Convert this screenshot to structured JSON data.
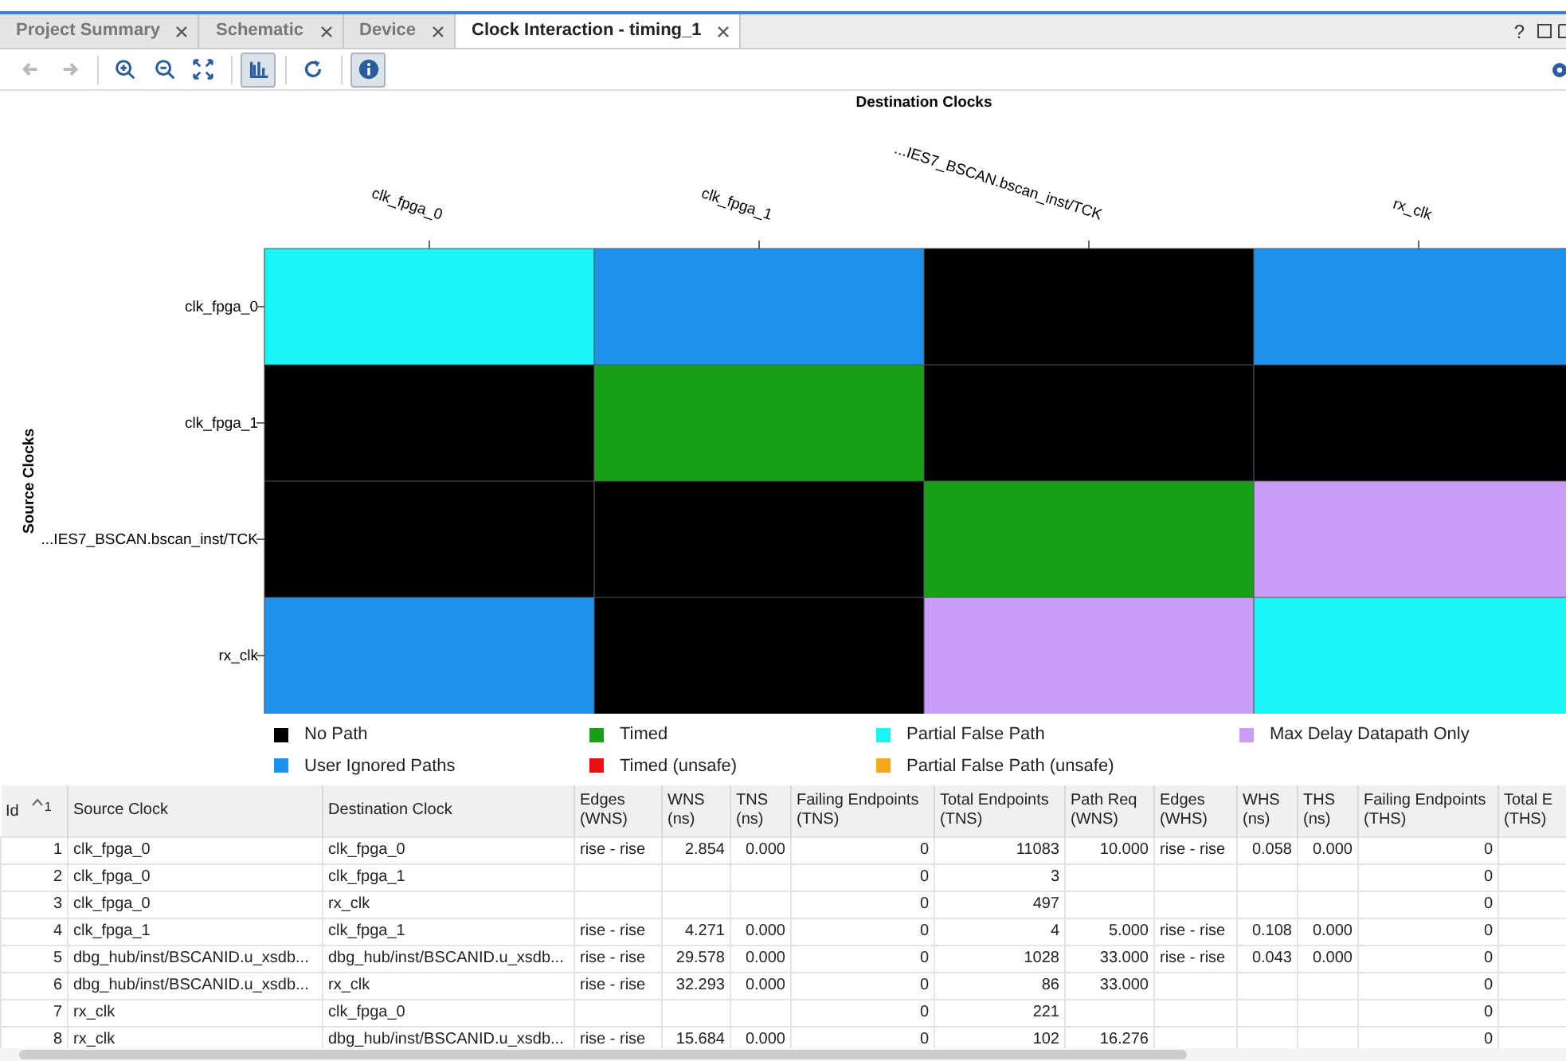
{
  "tabs": [
    {
      "label": "Project Summary",
      "selected": false
    },
    {
      "label": "Schematic",
      "selected": false
    },
    {
      "label": "Device",
      "selected": false
    },
    {
      "label": "Clock Interaction - timing_1",
      "selected": true
    }
  ],
  "window_controls": [
    {
      "label": "?"
    }
  ],
  "toolbar": [
    {
      "kind": "back",
      "disabled": true,
      "pressed": false
    },
    {
      "kind": "forward",
      "disabled": true,
      "pressed": false
    },
    {
      "kind": "zoom-in",
      "disabled": false,
      "pressed": false
    },
    {
      "kind": "zoom-out",
      "disabled": false,
      "pressed": false
    },
    {
      "kind": "fit",
      "disabled": false,
      "pressed": false
    },
    {
      "kind": "chart",
      "disabled": false,
      "pressed": true
    },
    {
      "kind": "refresh",
      "disabled": false,
      "pressed": false
    },
    {
      "kind": "info",
      "disabled": false,
      "pressed": true
    }
  ],
  "matrix": {
    "title": "Destination Clocks",
    "row_axis": "Source Clocks",
    "columns": [
      "clk_fpga_0",
      "clk_fpga_1",
      "...IES7_BSCAN.bscan_inst/TCK",
      "rx_clk"
    ],
    "rows": [
      {
        "label": "clk_fpga_0",
        "cells": [
          {
            "color": "#19f5f5"
          },
          {
            "color": "#1e93ee"
          },
          {
            "color": "#000000"
          },
          {
            "color": "#1e93ee"
          }
        ]
      },
      {
        "label": "clk_fpga_1",
        "cells": [
          {
            "color": "#000000"
          },
          {
            "color": "#16a016"
          },
          {
            "color": "#000000"
          },
          {
            "color": "#000000"
          }
        ]
      },
      {
        "label": "...IES7_BSCAN.bscan_inst/TCK",
        "cells": [
          {
            "color": "#000000"
          },
          {
            "color": "#000000"
          },
          {
            "color": "#16a016"
          },
          {
            "color": "#c99cf5"
          }
        ]
      },
      {
        "label": "rx_clk",
        "cells": [
          {
            "color": "#1e93ee"
          },
          {
            "color": "#000000"
          },
          {
            "color": "#c99cf5"
          },
          {
            "color": "#19f5f5"
          }
        ]
      }
    ]
  },
  "legend": [
    {
      "label": "No Path",
      "color": "#000000"
    },
    {
      "label": "Timed",
      "color": "#16a016"
    },
    {
      "label": "Partial False Path",
      "color": "#19f5f5"
    },
    {
      "label": "Max Delay Datapath Only",
      "color": "#c99cf5"
    },
    {
      "label": "User Ignored Paths",
      "color": "#1e93ee"
    },
    {
      "label": "Timed (unsafe)",
      "color": "#e81010"
    },
    {
      "label": "Partial False Path (unsafe)",
      "color": "#f5a623"
    }
  ],
  "table": {
    "columns": [
      {
        "label": "Id",
        "sort_index": "1"
      },
      {
        "label": "Source Clock"
      },
      {
        "label": "Destination Clock"
      },
      {
        "label": "Edges\n(WNS)"
      },
      {
        "label": "WNS\n(ns)"
      },
      {
        "label": "TNS\n(ns)"
      },
      {
        "label": "Failing Endpoints\n(TNS)"
      },
      {
        "label": "Total Endpoints\n(TNS)"
      },
      {
        "label": "Path Req\n(WNS)"
      },
      {
        "label": "Edges\n(WHS)"
      },
      {
        "label": "WHS\n(ns)"
      },
      {
        "label": "THS\n(ns)"
      },
      {
        "label": "Failing Endpoints\n(THS)"
      },
      {
        "label": "Total E\n(THS)"
      }
    ],
    "rows": [
      [
        "1",
        "clk_fpga_0",
        "clk_fpga_0",
        "rise - rise",
        "2.854",
        "0.000",
        "0",
        "11083",
        "10.000",
        "rise - rise",
        "0.058",
        "0.000",
        "0",
        null
      ],
      [
        "2",
        "clk_fpga_0",
        "clk_fpga_1",
        null,
        null,
        null,
        "0",
        "3",
        null,
        null,
        null,
        null,
        "0",
        null
      ],
      [
        "3",
        "clk_fpga_0",
        "rx_clk",
        null,
        null,
        null,
        "0",
        "497",
        null,
        null,
        null,
        null,
        "0",
        null
      ],
      [
        "4",
        "clk_fpga_1",
        "clk_fpga_1",
        "rise - rise",
        "4.271",
        "0.000",
        "0",
        "4",
        "5.000",
        "rise - rise",
        "0.108",
        "0.000",
        "0",
        null
      ],
      [
        "5",
        "dbg_hub/inst/BSCANID.u_xsdb...",
        "dbg_hub/inst/BSCANID.u_xsdb...",
        "rise - rise",
        "29.578",
        "0.000",
        "0",
        "1028",
        "33.000",
        "rise - rise",
        "0.043",
        "0.000",
        "0",
        null
      ],
      [
        "6",
        "dbg_hub/inst/BSCANID.u_xsdb...",
        "rx_clk",
        "rise - rise",
        "32.293",
        "0.000",
        "0",
        "86",
        "33.000",
        null,
        null,
        null,
        "0",
        null
      ],
      [
        "7",
        "rx_clk",
        "clk_fpga_0",
        null,
        null,
        null,
        "0",
        "221",
        null,
        null,
        null,
        null,
        "0",
        null
      ],
      [
        "8",
        "rx_clk",
        "dbg_hub/inst/BSCANID.u_xsdb...",
        "rise - rise",
        "15.684",
        "0.000",
        "0",
        "102",
        "16.276",
        null,
        null,
        null,
        "0",
        null
      ]
    ]
  }
}
